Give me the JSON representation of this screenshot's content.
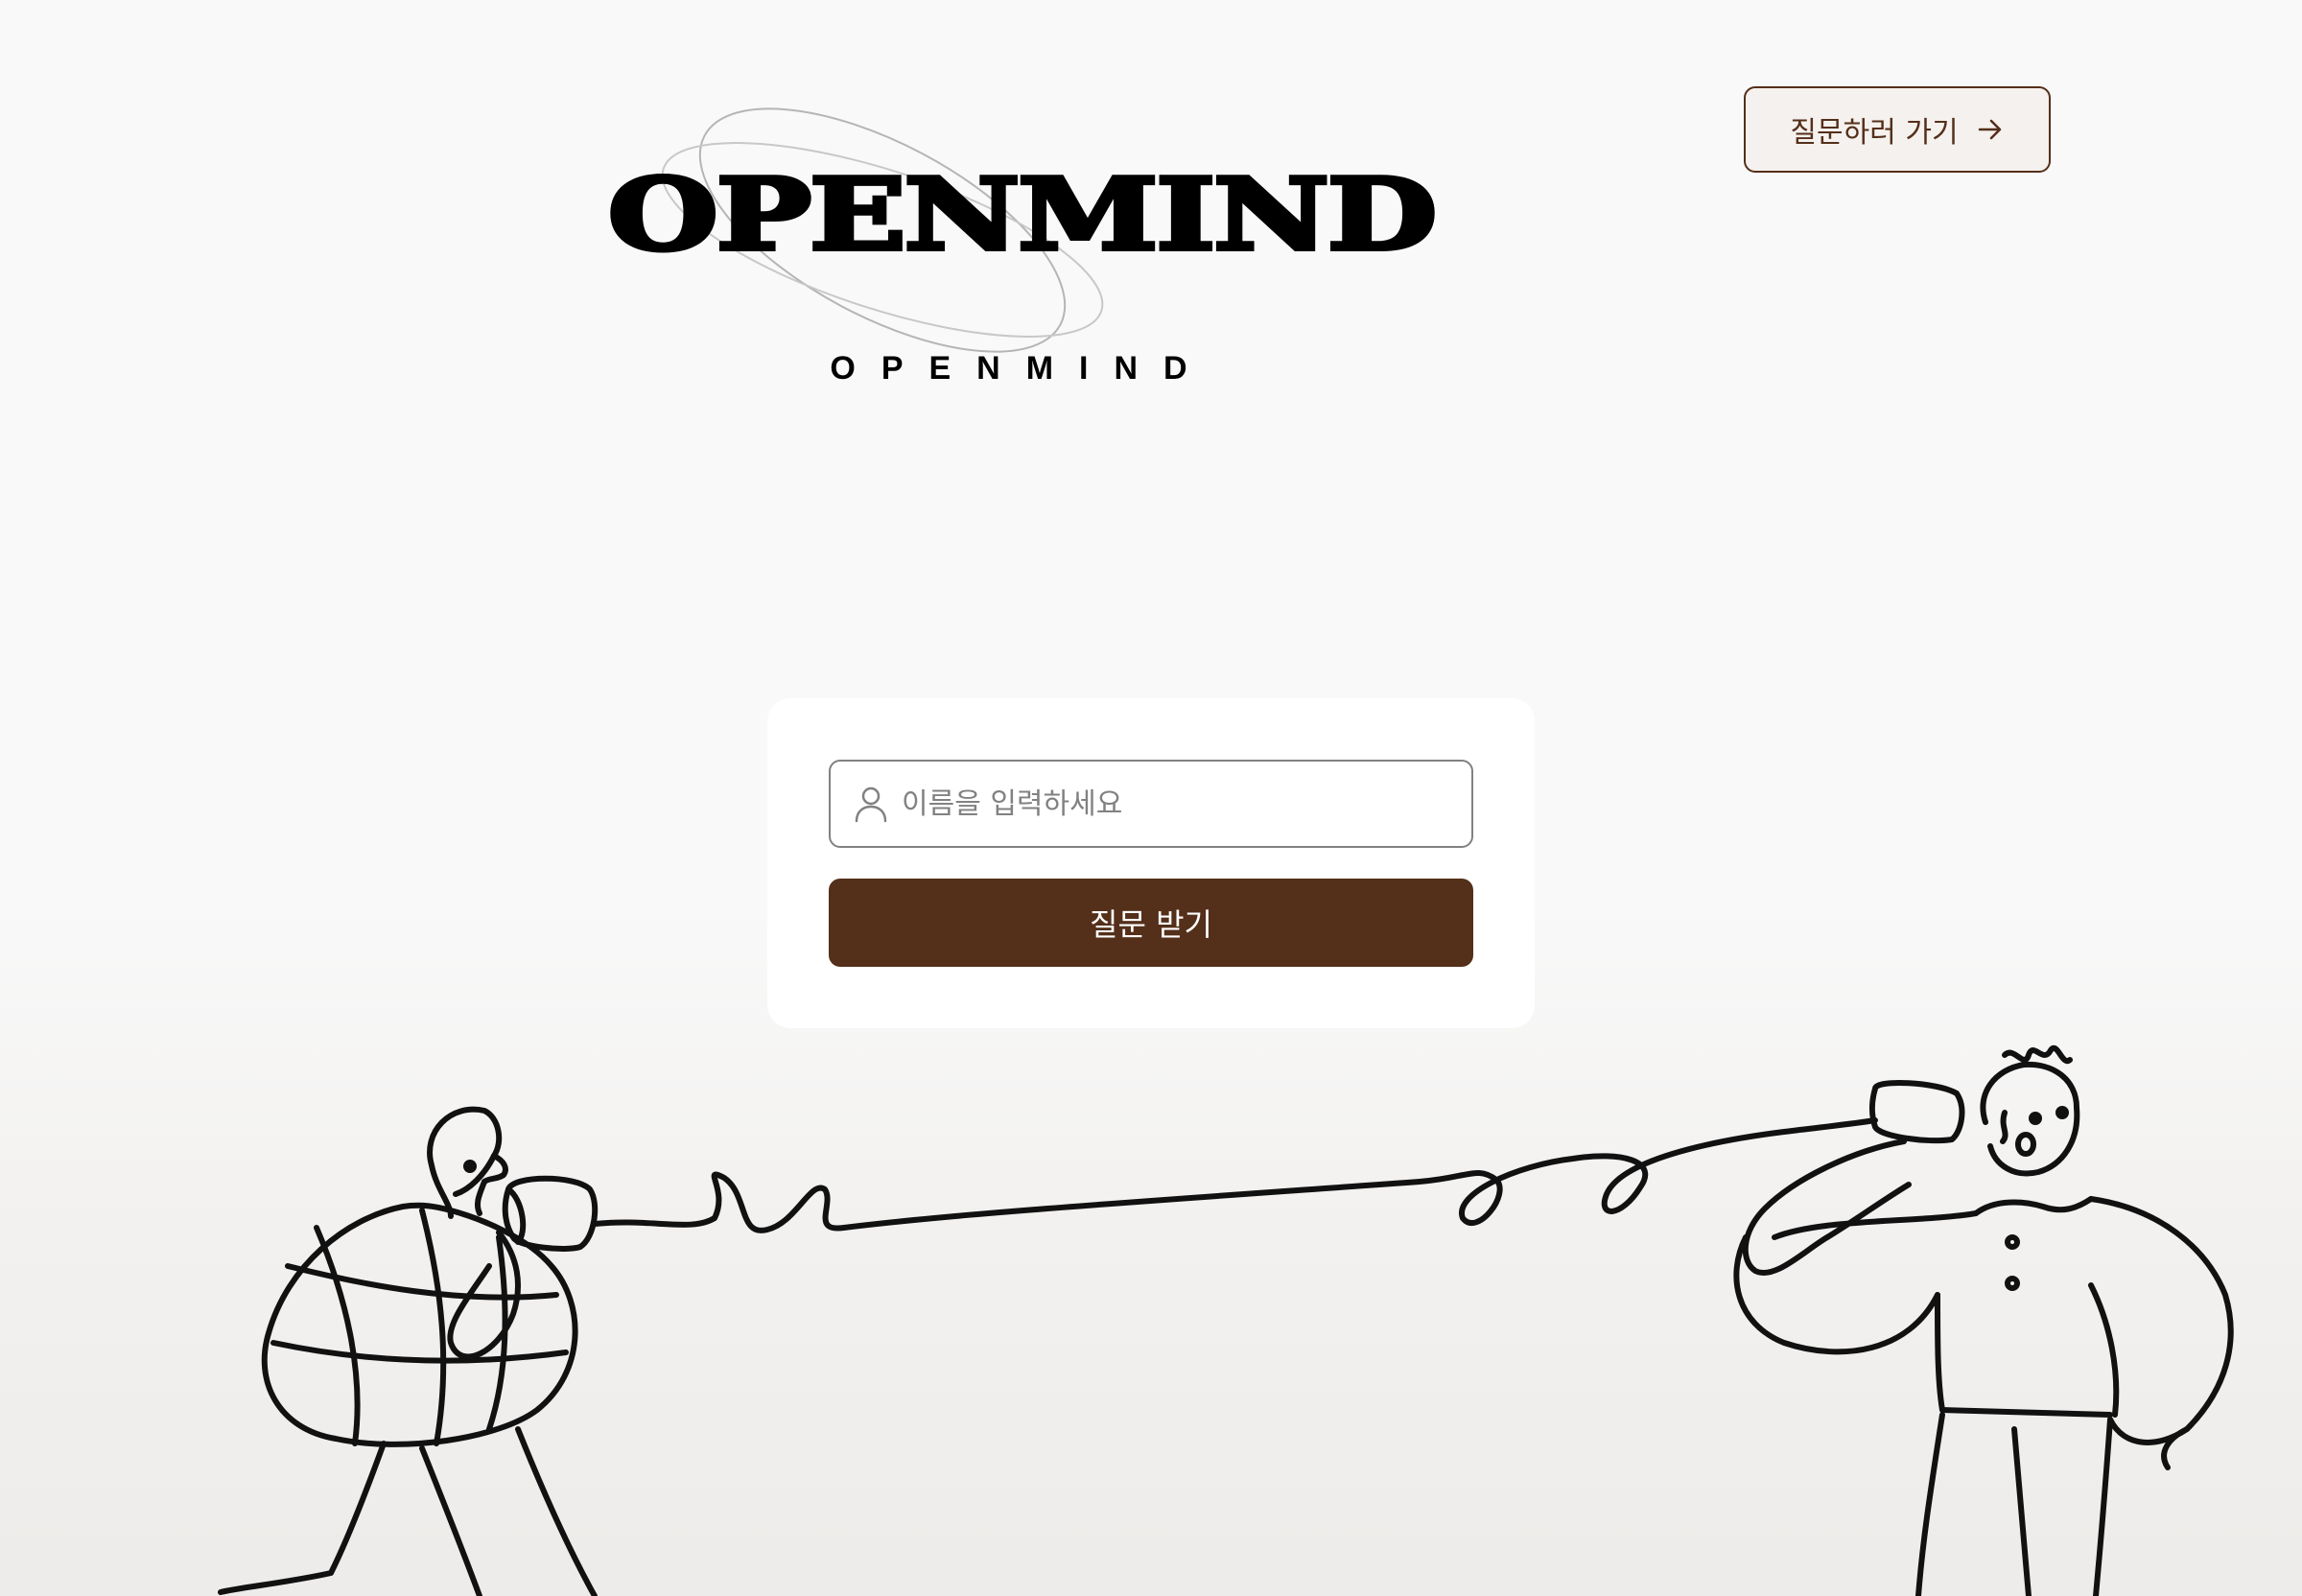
{
  "logo": {
    "wordmark": "OPENMIND",
    "subtitle": "OPENMIND"
  },
  "header": {
    "go_ask_label": "질문하러 가기",
    "go_ask_icon": "arrow-right-icon"
  },
  "form": {
    "name_placeholder": "이름을 입력하세요",
    "name_value": "",
    "person_icon": "person-icon",
    "submit_label": "질문 받기"
  },
  "colors": {
    "brand_brown": "#542f1a",
    "button_bg_light": "#f5f1ee",
    "page_bg": "#f9f9f9",
    "input_border": "#818181"
  }
}
